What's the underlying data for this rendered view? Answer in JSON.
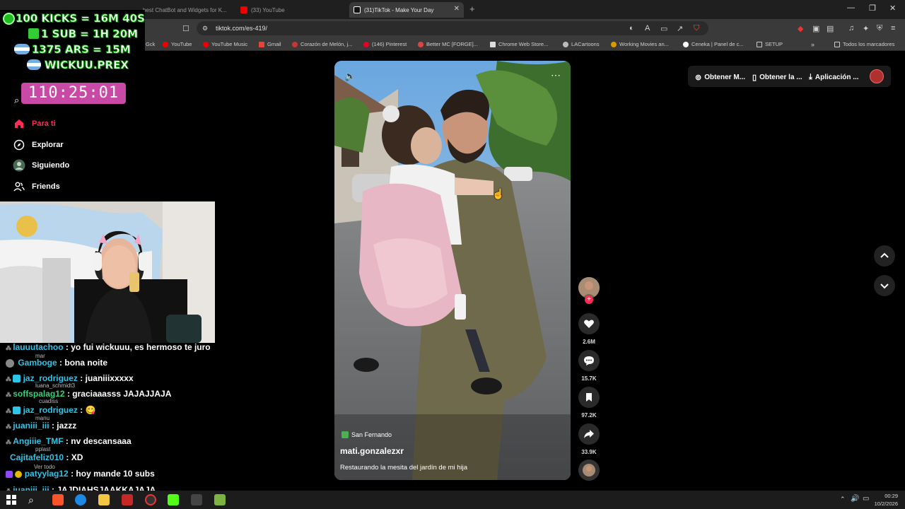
{
  "browser": {
    "tabs": [
      {
        "label": "best ChatBot and Widgets for K..."
      },
      {
        "label": "(33) YouTube"
      },
      {
        "label": "(31)TikTok - Make Your Day"
      }
    ],
    "url": "tiktok.com/es-419/",
    "bookmarks": [
      "Gck",
      "YouTube",
      "YouTube Music",
      "Gmail",
      "Corazón de Melón, j...",
      "(146) Pinterest",
      "Better MC [FORGE]...",
      "Chrome Web Store...",
      "LACartoons",
      "Working Movies an...",
      "Ceneka | Panel de c...",
      "SETUP",
      "Todos los marcadores"
    ]
  },
  "overlay": {
    "goals": [
      "100 KICKS = 16M 40S",
      "1 SUB = 1H 20M",
      "1375 ARS = 15M",
      "WICKUU.PREX"
    ],
    "timer": "110:25:01"
  },
  "nav": {
    "items": [
      "Para ti",
      "Explorar",
      "Siguiendo",
      "Friends"
    ]
  },
  "chat": {
    "lines": [
      {
        "user": "lauuutachoo",
        "msg": ": yo fui wickuuu, es hermoso te juro"
      },
      {
        "user": "Gamboge",
        "msg": ": bona noite"
      },
      {
        "user": "jaz_rodriguez",
        "msg": ": juaniiixxxxx"
      },
      {
        "user": "soffspalag12",
        "msg": ": graciaaasss JAJAJJAJA"
      },
      {
        "user": "jaz_rodriguez",
        "msg": ": 😋"
      },
      {
        "user": "juaniii_iii",
        "msg": ": jazzz"
      },
      {
        "user": "Angiiie_TMF",
        "msg": ": nv descansaaa"
      },
      {
        "user": "Cajitafeliz010",
        "msg": ": XD"
      },
      {
        "user": "patyylag12",
        "msg": ": hoy mande 10 subs"
      },
      {
        "user": "juaniii_iii",
        "msg": ": JAJDIAHSJAAKKAJAJA"
      }
    ],
    "ghosts": [
      "mar",
      "luana_schmidt3",
      "cuadiss",
      "manu",
      "pplast",
      "Ver todo"
    ]
  },
  "video": {
    "location": "San Fernando",
    "author": "mati.gonzalezxr",
    "caption": "Restaurando la mesita del jardín de mi hija"
  },
  "actions": {
    "likes": "2.6M",
    "comments": "15.7K",
    "saves": "97.2K",
    "shares": "33.9K"
  },
  "topbar": {
    "btn1": "Obtener M...",
    "btn2": "Obtener la ...",
    "btn3": "Aplicación ..."
  },
  "taskbar": {
    "time": "00:29",
    "date": "10/2/2026"
  },
  "colors": {
    "accent": "#fe2c55",
    "timer": "#c94aa6",
    "chat_user": "#2ec4e8"
  }
}
